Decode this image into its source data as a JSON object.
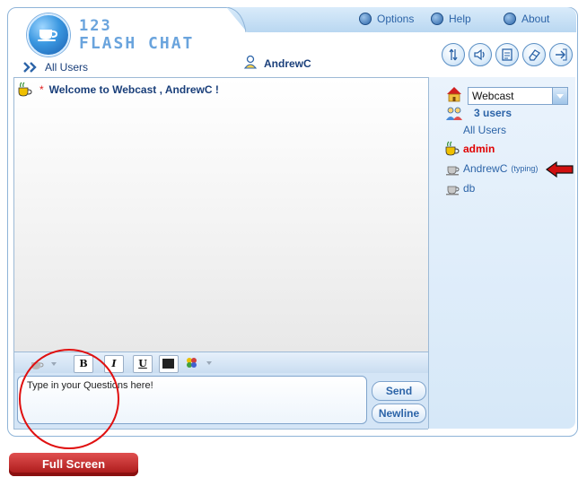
{
  "logo": {
    "line1": "123",
    "line2": "FLASH CHAT"
  },
  "menu": {
    "options": "Options",
    "help": "Help",
    "about": "About"
  },
  "toolbar_icons": [
    "sort-icon",
    "sound-icon",
    "notes-icon",
    "eraser-icon",
    "exit-icon"
  ],
  "header": {
    "all_users_label": "All Users",
    "current_user": "AndrewC"
  },
  "chat": {
    "messages": [
      {
        "star": "*",
        "text": "Welcome to Webcast , AndrewC !"
      }
    ]
  },
  "format": {
    "bold": "B",
    "italic": "I",
    "underline": "U",
    "color": "#222222"
  },
  "input": {
    "placeholder": "Type in your Questions here!",
    "value": "Type in your Questions here!"
  },
  "buttons": {
    "send": "Send",
    "newline": "Newline",
    "full_screen": "Full Screen"
  },
  "room": {
    "selected": "Webcast",
    "users_count": "3 users",
    "all_users_link": "All Users",
    "users": [
      {
        "name": "admin",
        "status": "",
        "color": "#e00000",
        "bold": true
      },
      {
        "name": "AndrewC",
        "status": "(typing)",
        "color": "#2c64a8",
        "bold": false
      },
      {
        "name": "db",
        "status": "",
        "color": "#2c64a8",
        "bold": false
      }
    ]
  },
  "colors": {
    "accent": "#2c64a8",
    "frame": "#8fb4d8",
    "annotation": "#e01010",
    "fullscreen_button": "#c62828"
  }
}
